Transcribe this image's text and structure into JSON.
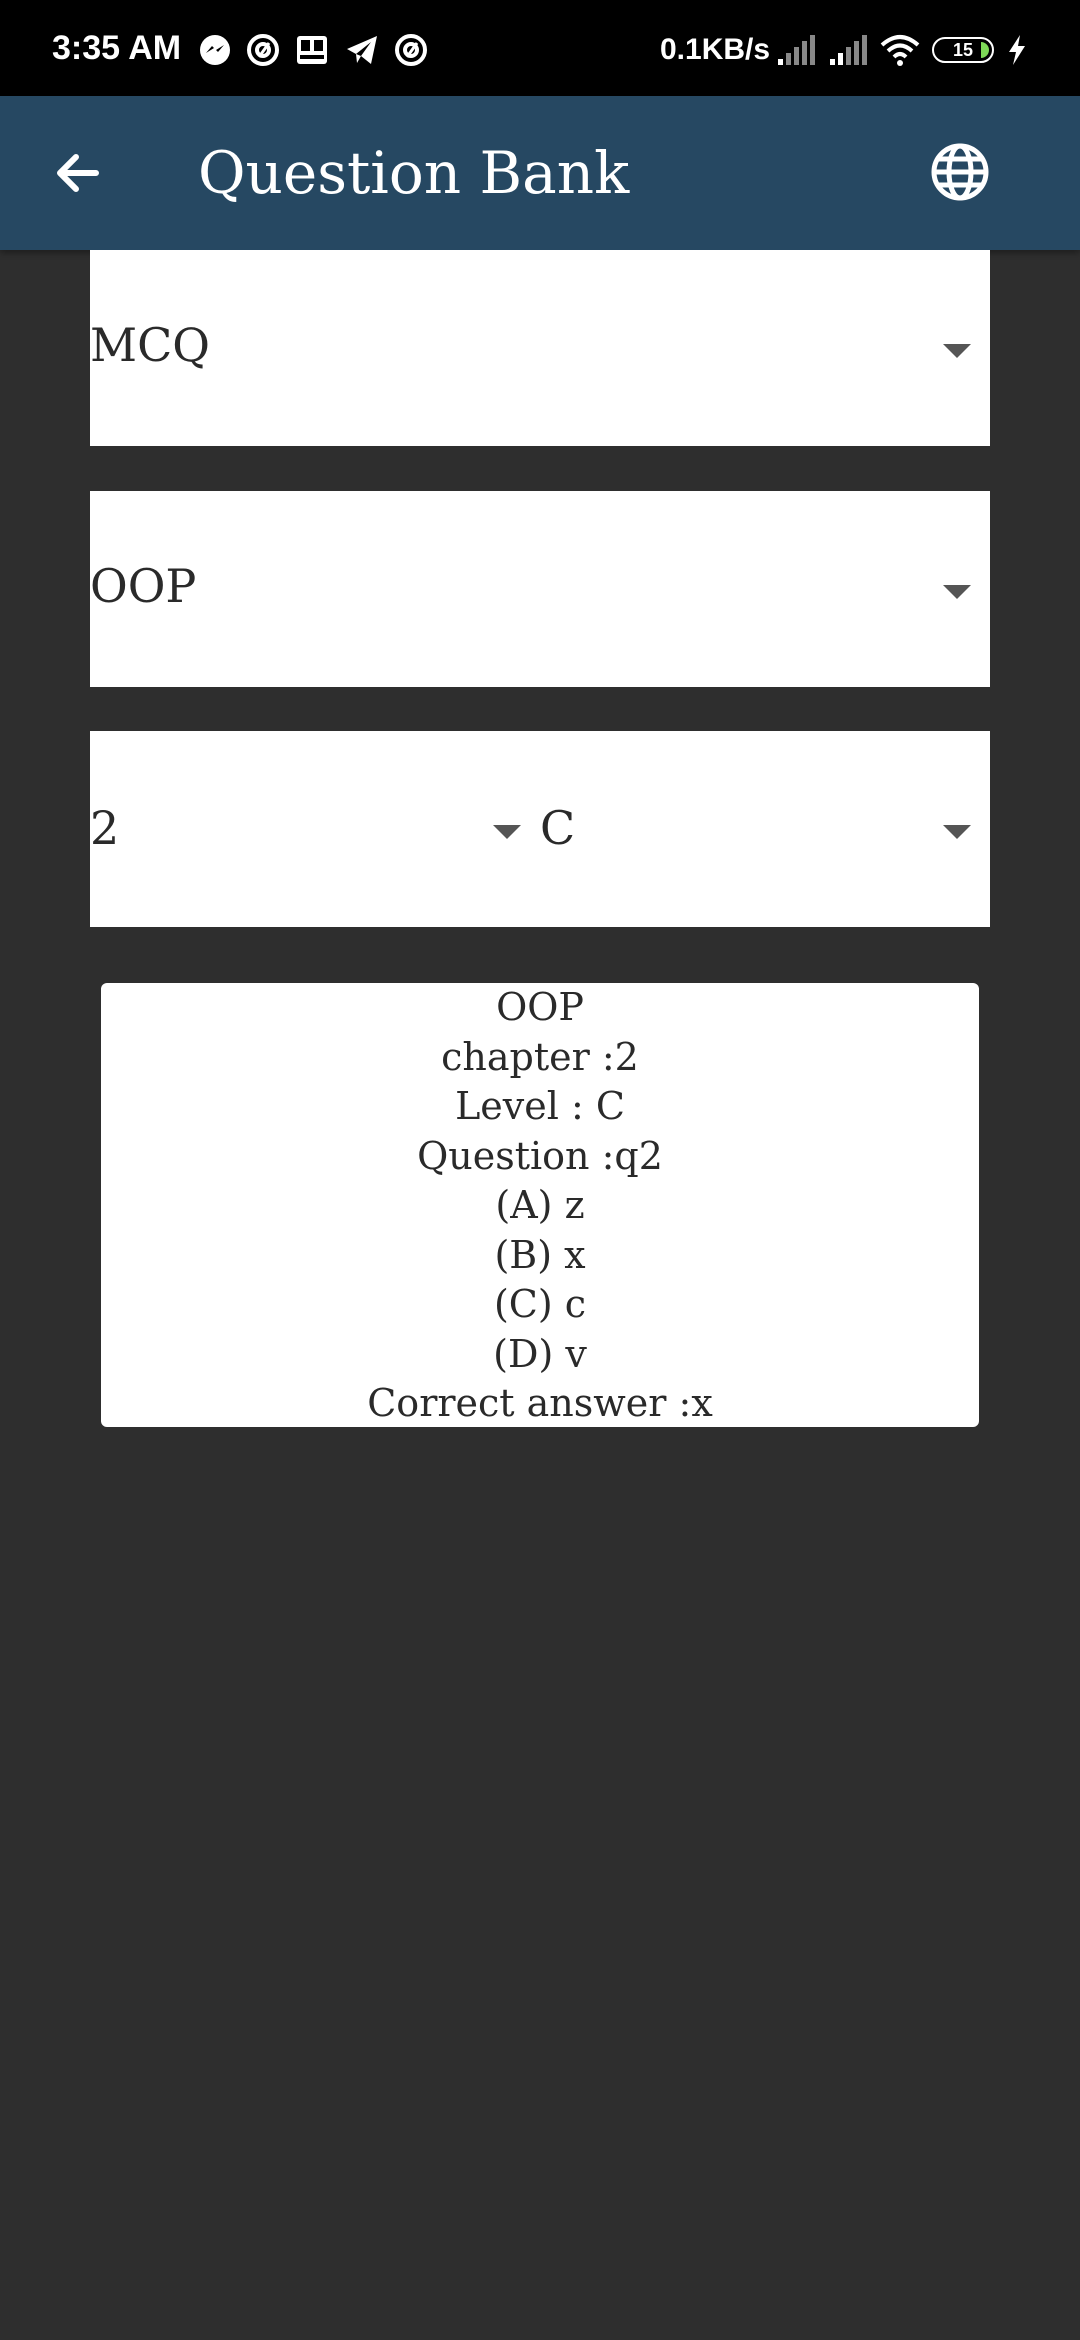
{
  "status_bar": {
    "time": "3:35 AM",
    "network_speed": "0.1KB/s",
    "battery_level": "15",
    "left_icons": [
      "messenger-icon",
      "at-icon",
      "game-icon",
      "telegram-icon",
      "at-icon"
    ],
    "right_icons": [
      "signal-icon",
      "signal-icon",
      "wifi-icon",
      "battery-icon",
      "charging-icon"
    ]
  },
  "app_bar": {
    "title": "Question Bank",
    "back_icon": "arrow-left-icon",
    "language_icon": "globe-icon",
    "color": "#264862"
  },
  "filters": {
    "question_type": "MCQ",
    "subject": "OOP",
    "chapter": "2",
    "level": "C"
  },
  "question_card": {
    "subject": "OOP",
    "chapter": "chapter :2",
    "level": "Level : C",
    "question": "Question :q2",
    "option_a": "(A) z",
    "option_b": "(B) x",
    "option_c": "(C) c",
    "option_d": "(D) v",
    "correct_answer": "Correct answer :x"
  },
  "colors": {
    "background": "#2e2e2e",
    "status_bar": "#000000",
    "card": "#ffffff"
  }
}
